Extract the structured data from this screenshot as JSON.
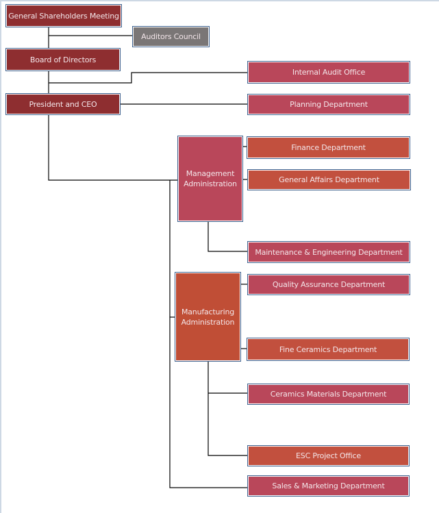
{
  "nodes": {
    "gsm": "General Shareholders Meeting",
    "auditors": "Auditors Council",
    "board": "Board of Directors",
    "ceo": "President and CEO",
    "internal_audit": "Internal Audit Office",
    "planning": "Planning Department",
    "management": "Management Administration",
    "finance": "Finance Department",
    "general_affairs": "General Affairs Department",
    "maintenance": "Maintenance & Engineering Department",
    "manufacturing": "Manufacturing Administration",
    "quality": "Quality Assurance  Department",
    "fine_ceramics": "Fine Ceramics Department",
    "ceramics_materials": "Ceramics Materials Department",
    "esc": "ESC Project Office",
    "sales": "Sales & Marketing Department"
  },
  "colors": {
    "executive": "#8e2e30",
    "auditors": "#7a7676",
    "office": "#b9475a",
    "department": "#c2503e",
    "connector": "#000000",
    "border": "#3c5f8c"
  }
}
